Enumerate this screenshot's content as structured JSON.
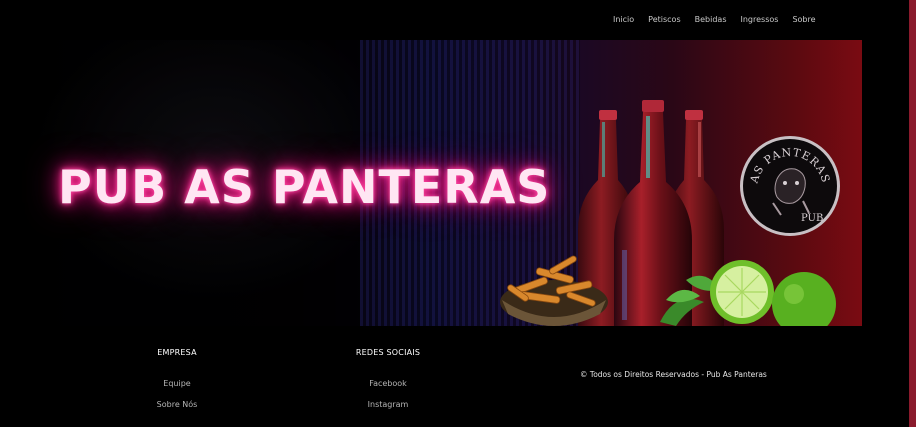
{
  "nav": {
    "items": [
      "Inicio",
      "Petiscos",
      "Bebidas",
      "Ingressos",
      "Sobre"
    ]
  },
  "hero": {
    "title": "PUB AS PANTERAS",
    "logo_text": "AS PANTERAS PUB"
  },
  "footer": {
    "empresa": {
      "heading": "EMPRESA",
      "links": [
        "Equipe",
        "Sobre Nós"
      ]
    },
    "redes": {
      "heading": "REDES SOCIAIS",
      "links": [
        "Facebook",
        "Instagram"
      ]
    },
    "copyright": "© Todos os Direitos Reservados - Pub As Panteras"
  },
  "colors": {
    "neon_pink": "#ff2b8f",
    "accent_bar": "#8a1a2c",
    "background": "#000000"
  }
}
